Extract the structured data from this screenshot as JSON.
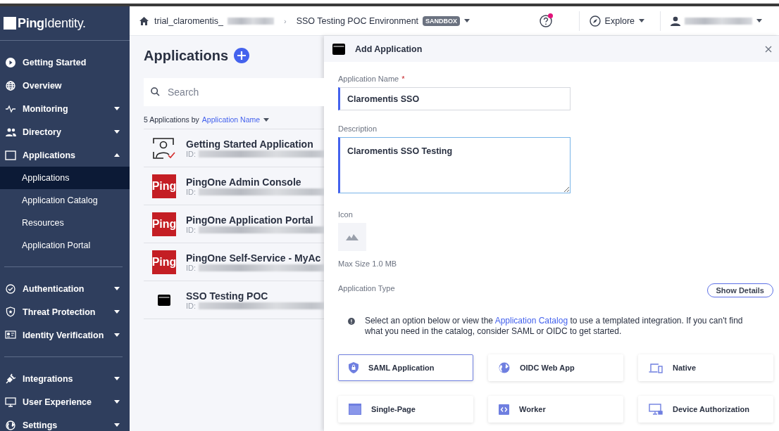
{
  "sidebar": {
    "logo": "**Ping**Identity.",
    "groups": [
      {
        "items": [
          {
            "label": "Getting Started",
            "kind": "link"
          },
          {
            "label": "Overview",
            "kind": "link"
          },
          {
            "label": "Monitoring",
            "kind": "menu",
            "expanded": false
          },
          {
            "label": "Directory",
            "kind": "menu",
            "expanded": false
          },
          {
            "label": "Applications",
            "kind": "menu",
            "expanded": true,
            "children": [
              {
                "label": "Applications",
                "selected": true
              },
              {
                "label": "Application Catalog",
                "selected": false
              },
              {
                "label": "Resources",
                "selected": false
              },
              {
                "label": "Application Portal",
                "selected": false
              }
            ]
          }
        ]
      },
      {
        "items": [
          {
            "label": "Authentication",
            "kind": "menu",
            "expanded": false
          },
          {
            "label": "Threat Protection",
            "kind": "menu",
            "expanded": false
          },
          {
            "label": "Identity Verification",
            "kind": "menu",
            "expanded": false
          }
        ]
      },
      {
        "items": [
          {
            "label": "Integrations",
            "kind": "menu",
            "expanded": false
          },
          {
            "label": "User Experience",
            "kind": "menu",
            "expanded": false
          },
          {
            "label": "Settings",
            "kind": "menu",
            "expanded": false
          }
        ]
      }
    ]
  },
  "header": {
    "breadcrumb": [
      {
        "label": "trial_claromentis_",
        "redacted": true
      },
      {
        "separator": "›",
        "label": "SSO Testing POC Environment",
        "badge": "SANDBOX"
      }
    ],
    "help": {
      "notification": true
    },
    "explore": "Explore",
    "user": {
      "redacted": true
    }
  },
  "applications": {
    "title": "Applications",
    "search": {
      "placeholder": "Search"
    },
    "summary": "5 Applications by",
    "sort": "Application Name",
    "items": [
      {
        "name": "Getting Started Application",
        "id_label": "ID:",
        "kind": "person"
      },
      {
        "name": "PingOne Admin Console",
        "id_label": "ID:",
        "kind": "ping",
        "logo_text": "Ping"
      },
      {
        "name": "PingOne Application Portal",
        "id_label": "ID:",
        "kind": "ping",
        "logo_text": "Ping"
      },
      {
        "name": "PingOne Self-Service - MyAc",
        "id_label": "ID:",
        "kind": "ping",
        "logo_text": "Ping"
      },
      {
        "name": "SSO Testing POC",
        "id_label": "ID:",
        "kind": "window"
      }
    ]
  },
  "panel": {
    "title": "Add Application",
    "fields": [
      {
        "label": "Application Name",
        "required_mark": "*",
        "value": "Claromentis SSO",
        "kind": "input",
        "focused": false
      },
      {
        "label": "Description",
        "value": "Claromentis SSO Testing",
        "kind": "textarea",
        "focused": true
      }
    ],
    "icon": {
      "label": "Icon",
      "note": "Max Size 1.0 MB"
    },
    "type": {
      "label": "Application Type",
      "details_button": "Show Details",
      "info": {
        "before": "Select an option below or view the ",
        "link": "Application Catalog",
        "after": " to use a templated integration. If you can't find what you need in the catalog, consider SAML or OIDC to get started."
      },
      "options": [
        {
          "label": "SAML Application",
          "selected": true
        },
        {
          "label": "OIDC Web App",
          "selected": false
        },
        {
          "label": "Native",
          "selected": false
        },
        {
          "label": "Single-Page",
          "selected": false
        },
        {
          "label": "Worker",
          "selected": false
        },
        {
          "label": "Device Authorization",
          "selected": false
        }
      ]
    }
  }
}
